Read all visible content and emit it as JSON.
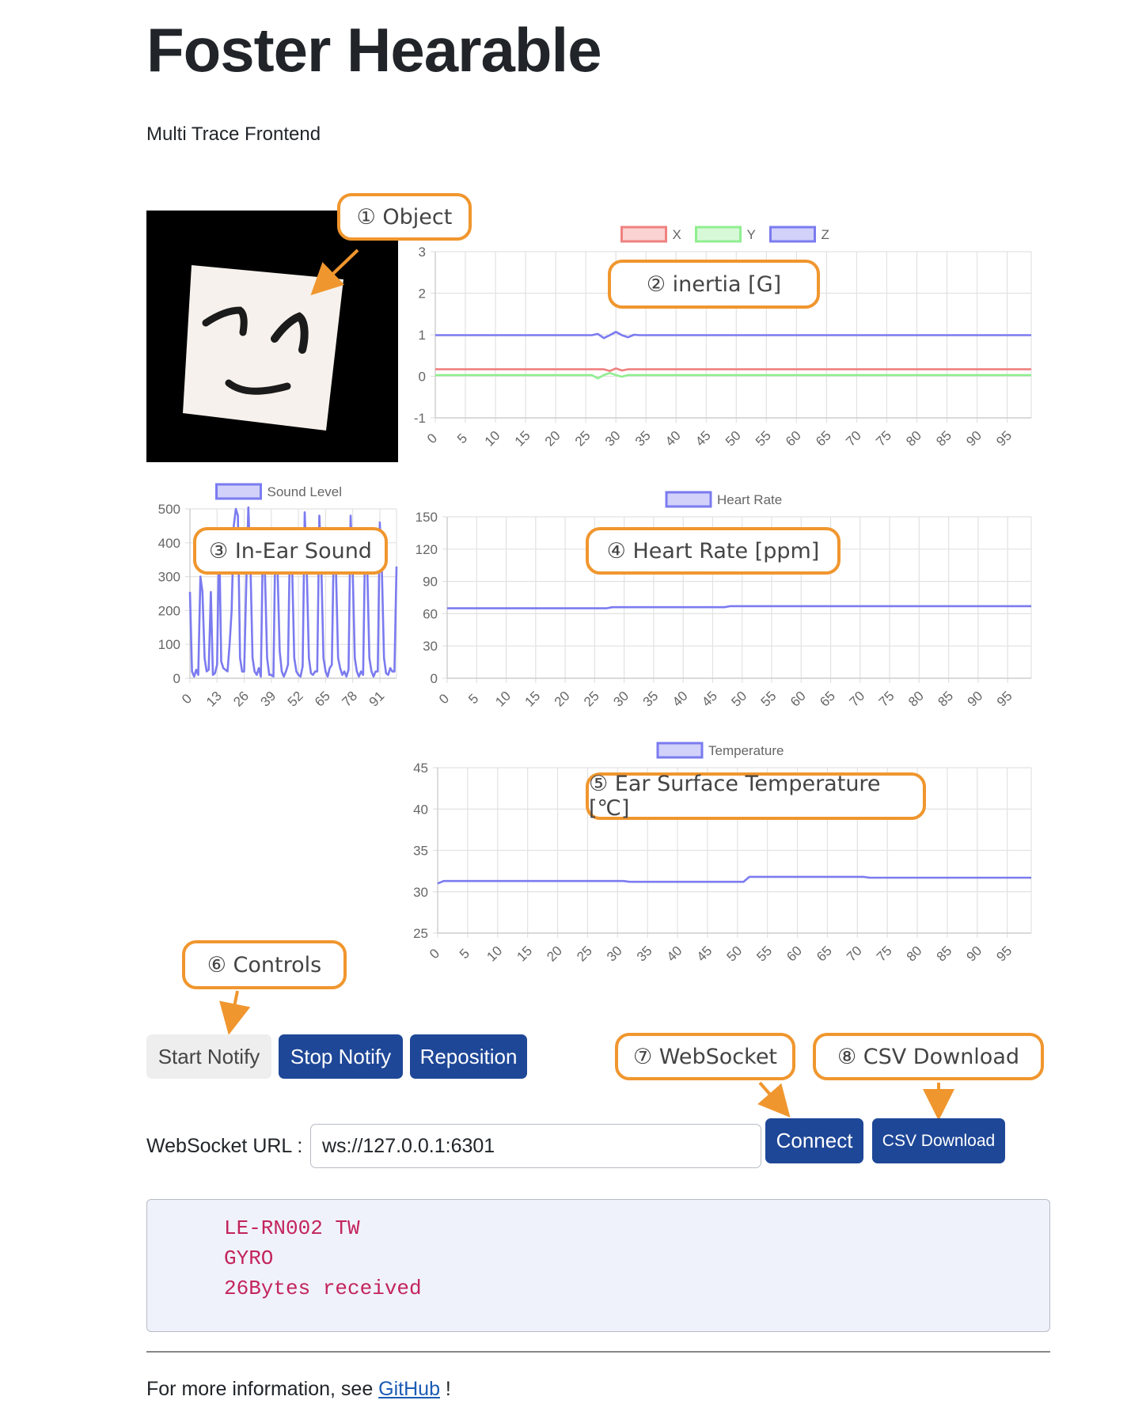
{
  "page": {
    "title": "Foster Hearable",
    "subtitle": "Multi Trace Frontend"
  },
  "callouts": {
    "object": "① Object",
    "inertia": "② inertia [G]",
    "sound": "③ In-Ear Sound",
    "heart": "④ Heart Rate [ppm]",
    "temperature": "⑤ Ear Surface Temperature [℃]",
    "controls": "⑥ Controls",
    "websocket": "⑦ WebSocket",
    "csv": "⑧ CSV Download"
  },
  "controls": {
    "start_notify": "Start Notify",
    "stop_notify": "Stop Notify",
    "reposition": "Reposition"
  },
  "websocket": {
    "label": "WebSocket URL :",
    "url": "ws://127.0.0.1:6301",
    "connect": "Connect",
    "csv_download": "CSV Download"
  },
  "log": {
    "lines": [
      "LE-RN002 TW",
      "GYRO",
      "26Bytes received"
    ]
  },
  "footer": {
    "prefix": "For more information, see ",
    "link": "GitHub",
    "suffix": " !"
  },
  "colors": {
    "x": "#f08080",
    "y": "#90ee90",
    "z": "#7b7bf0",
    "accent": "#f0962e",
    "primary_button": "#1e4797"
  },
  "chart_data": [
    {
      "id": "inertia",
      "type": "line",
      "legend_position": "top",
      "grid": true,
      "ylim": [
        -1,
        3
      ],
      "yticks": [
        -1,
        0,
        1,
        2,
        3
      ],
      "x_count": 100,
      "xticks": [
        0,
        5,
        10,
        15,
        20,
        25,
        30,
        35,
        40,
        45,
        50,
        55,
        60,
        65,
        70,
        75,
        80,
        85,
        90,
        95
      ],
      "series": [
        {
          "name": "X",
          "color": "#f08080",
          "base": 0.17,
          "events": [
            [
              29,
              0.13
            ],
            [
              30,
              0.19
            ],
            [
              31,
              0.14
            ]
          ]
        },
        {
          "name": "Y",
          "color": "#90ee90",
          "base": 0.03,
          "events": [
            [
              27,
              -0.05
            ],
            [
              29,
              0.08
            ],
            [
              31,
              -0.01
            ]
          ]
        },
        {
          "name": "Z",
          "color": "#7b7bf0",
          "base": 0.99,
          "events": [
            [
              27,
              1.02
            ],
            [
              28,
              0.92
            ],
            [
              30,
              1.07
            ],
            [
              32,
              0.94
            ],
            [
              33,
              1.0
            ]
          ]
        }
      ]
    },
    {
      "id": "sound",
      "type": "line",
      "legend_position": "top",
      "grid": true,
      "ylim": [
        0,
        500
      ],
      "yticks": [
        0,
        100,
        200,
        300,
        400,
        500
      ],
      "x_count": 100,
      "xticks": [
        0,
        13,
        26,
        39,
        52,
        65,
        78,
        91
      ],
      "series": [
        {
          "name": "Sound Level",
          "color": "#7b7bf0",
          "values": [
            255,
            20,
            5,
            25,
            10,
            300,
            255,
            60,
            20,
            25,
            255,
            10,
            15,
            40,
            430,
            50,
            30,
            25,
            20,
            100,
            200,
            450,
            500,
            480,
            60,
            20,
            20,
            280,
            600,
            330,
            60,
            20,
            10,
            30,
            5,
            420,
            300,
            60,
            10,
            10,
            5,
            440,
            320,
            80,
            20,
            5,
            20,
            40,
            430,
            320,
            60,
            20,
            10,
            5,
            35,
            490,
            320,
            60,
            15,
            10,
            20,
            20,
            480,
            320,
            60,
            20,
            5,
            30,
            40,
            420,
            320,
            60,
            30,
            10,
            20,
            5,
            25,
            480,
            320,
            60,
            20,
            5,
            20,
            10,
            430,
            320,
            60,
            20,
            5,
            20,
            20,
            460,
            320,
            60,
            15,
            10,
            30,
            20,
            20,
            330
          ]
        }
      ]
    },
    {
      "id": "heart",
      "type": "line",
      "legend_position": "top",
      "grid": true,
      "ylim": [
        0,
        150
      ],
      "yticks": [
        0,
        30,
        60,
        90,
        120,
        150
      ],
      "x_count": 100,
      "xticks": [
        0,
        5,
        10,
        15,
        20,
        25,
        30,
        35,
        40,
        45,
        50,
        55,
        60,
        65,
        70,
        75,
        80,
        85,
        90,
        95
      ],
      "series": [
        {
          "name": "Heart Rate",
          "color": "#7b7bf0",
          "steps": [
            [
              0,
              65
            ],
            [
              28,
              66
            ],
            [
              48,
              67
            ]
          ]
        }
      ]
    },
    {
      "id": "temperature",
      "type": "line",
      "legend_position": "top",
      "grid": true,
      "ylim": [
        25,
        45
      ],
      "yticks": [
        25,
        30,
        35,
        40,
        45
      ],
      "x_count": 100,
      "xticks": [
        0,
        5,
        10,
        15,
        20,
        25,
        30,
        35,
        40,
        45,
        50,
        55,
        60,
        65,
        70,
        75,
        80,
        85,
        90,
        95
      ],
      "series": [
        {
          "name": "Temperature",
          "color": "#7b7bf0",
          "steps": [
            [
              0,
              31.0
            ],
            [
              1,
              31.3
            ],
            [
              32,
              31.2
            ],
            [
              52,
              31.8
            ],
            [
              72,
              31.7
            ]
          ]
        }
      ]
    }
  ]
}
